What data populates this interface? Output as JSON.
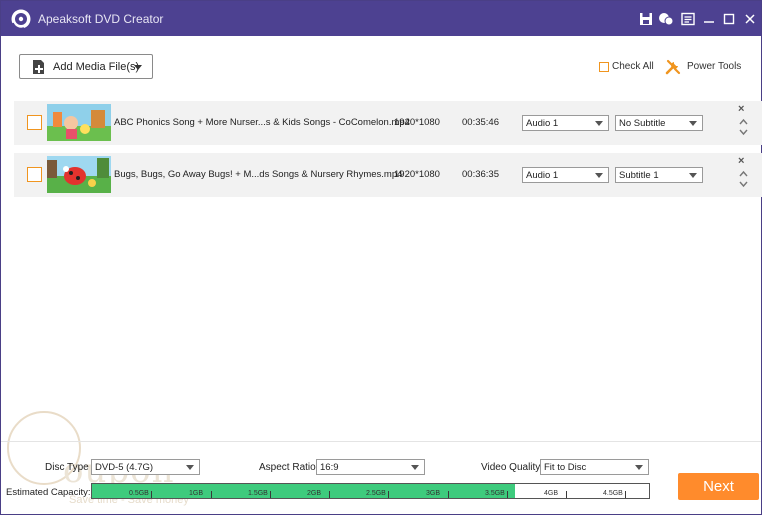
{
  "window": {
    "title": "Apeaksoft DVD Creator",
    "accent_color": "#4d4191",
    "titlebar_icons": [
      "save-icon",
      "feedback-icon",
      "menu-icon",
      "minimize-icon",
      "maximize-icon",
      "close-icon"
    ],
    "maximize_glyph": "☐",
    "close_glyph": "✕",
    "minimize_glyph": "—"
  },
  "toolbar": {
    "add_media_label": "Add Media File(s)",
    "check_all_label": "Check All",
    "power_tools_label": "Power Tools"
  },
  "files": [
    {
      "name": "ABC Phonics Song + More Nurser...s & Kids Songs - CoComelon.mp4",
      "resolution": "1920*1080",
      "duration": "00:35:46",
      "audio": "Audio 1",
      "subtitle": "No Subtitle"
    },
    {
      "name": "Bugs, Bugs, Go Away Bugs! + M...ds Songs & Nursery Rhymes.mp4",
      "resolution": "1920*1080",
      "duration": "00:36:35",
      "audio": "Audio 1",
      "subtitle": "Subtitle 1"
    }
  ],
  "row_controls": {
    "remove_glyph": "×"
  },
  "settings": {
    "disc_type_label": "Disc Type",
    "disc_type_value": "DVD-5 (4.7G)",
    "aspect_ratio_label": "Aspect Ratio:",
    "aspect_ratio_value": "16:9",
    "video_quality_label": "Video Quality:",
    "video_quality_value": "Fit to Disc",
    "capacity_label": "Estimated Capacity:"
  },
  "capacity": {
    "used_fraction": 0.76,
    "max_gb": 4.7,
    "ticks": [
      "0.5GB",
      "1GB",
      "1.5GB",
      "2GB",
      "2.5GB",
      "3GB",
      "3.5GB",
      "4GB",
      "4.5GB"
    ],
    "fill_color": "#3ecb7d"
  },
  "actions": {
    "next_label": "Next",
    "next_color": "#ff8b2c"
  },
  "watermark": {
    "word": "oupon",
    "tagline": "Save time - Save money"
  }
}
